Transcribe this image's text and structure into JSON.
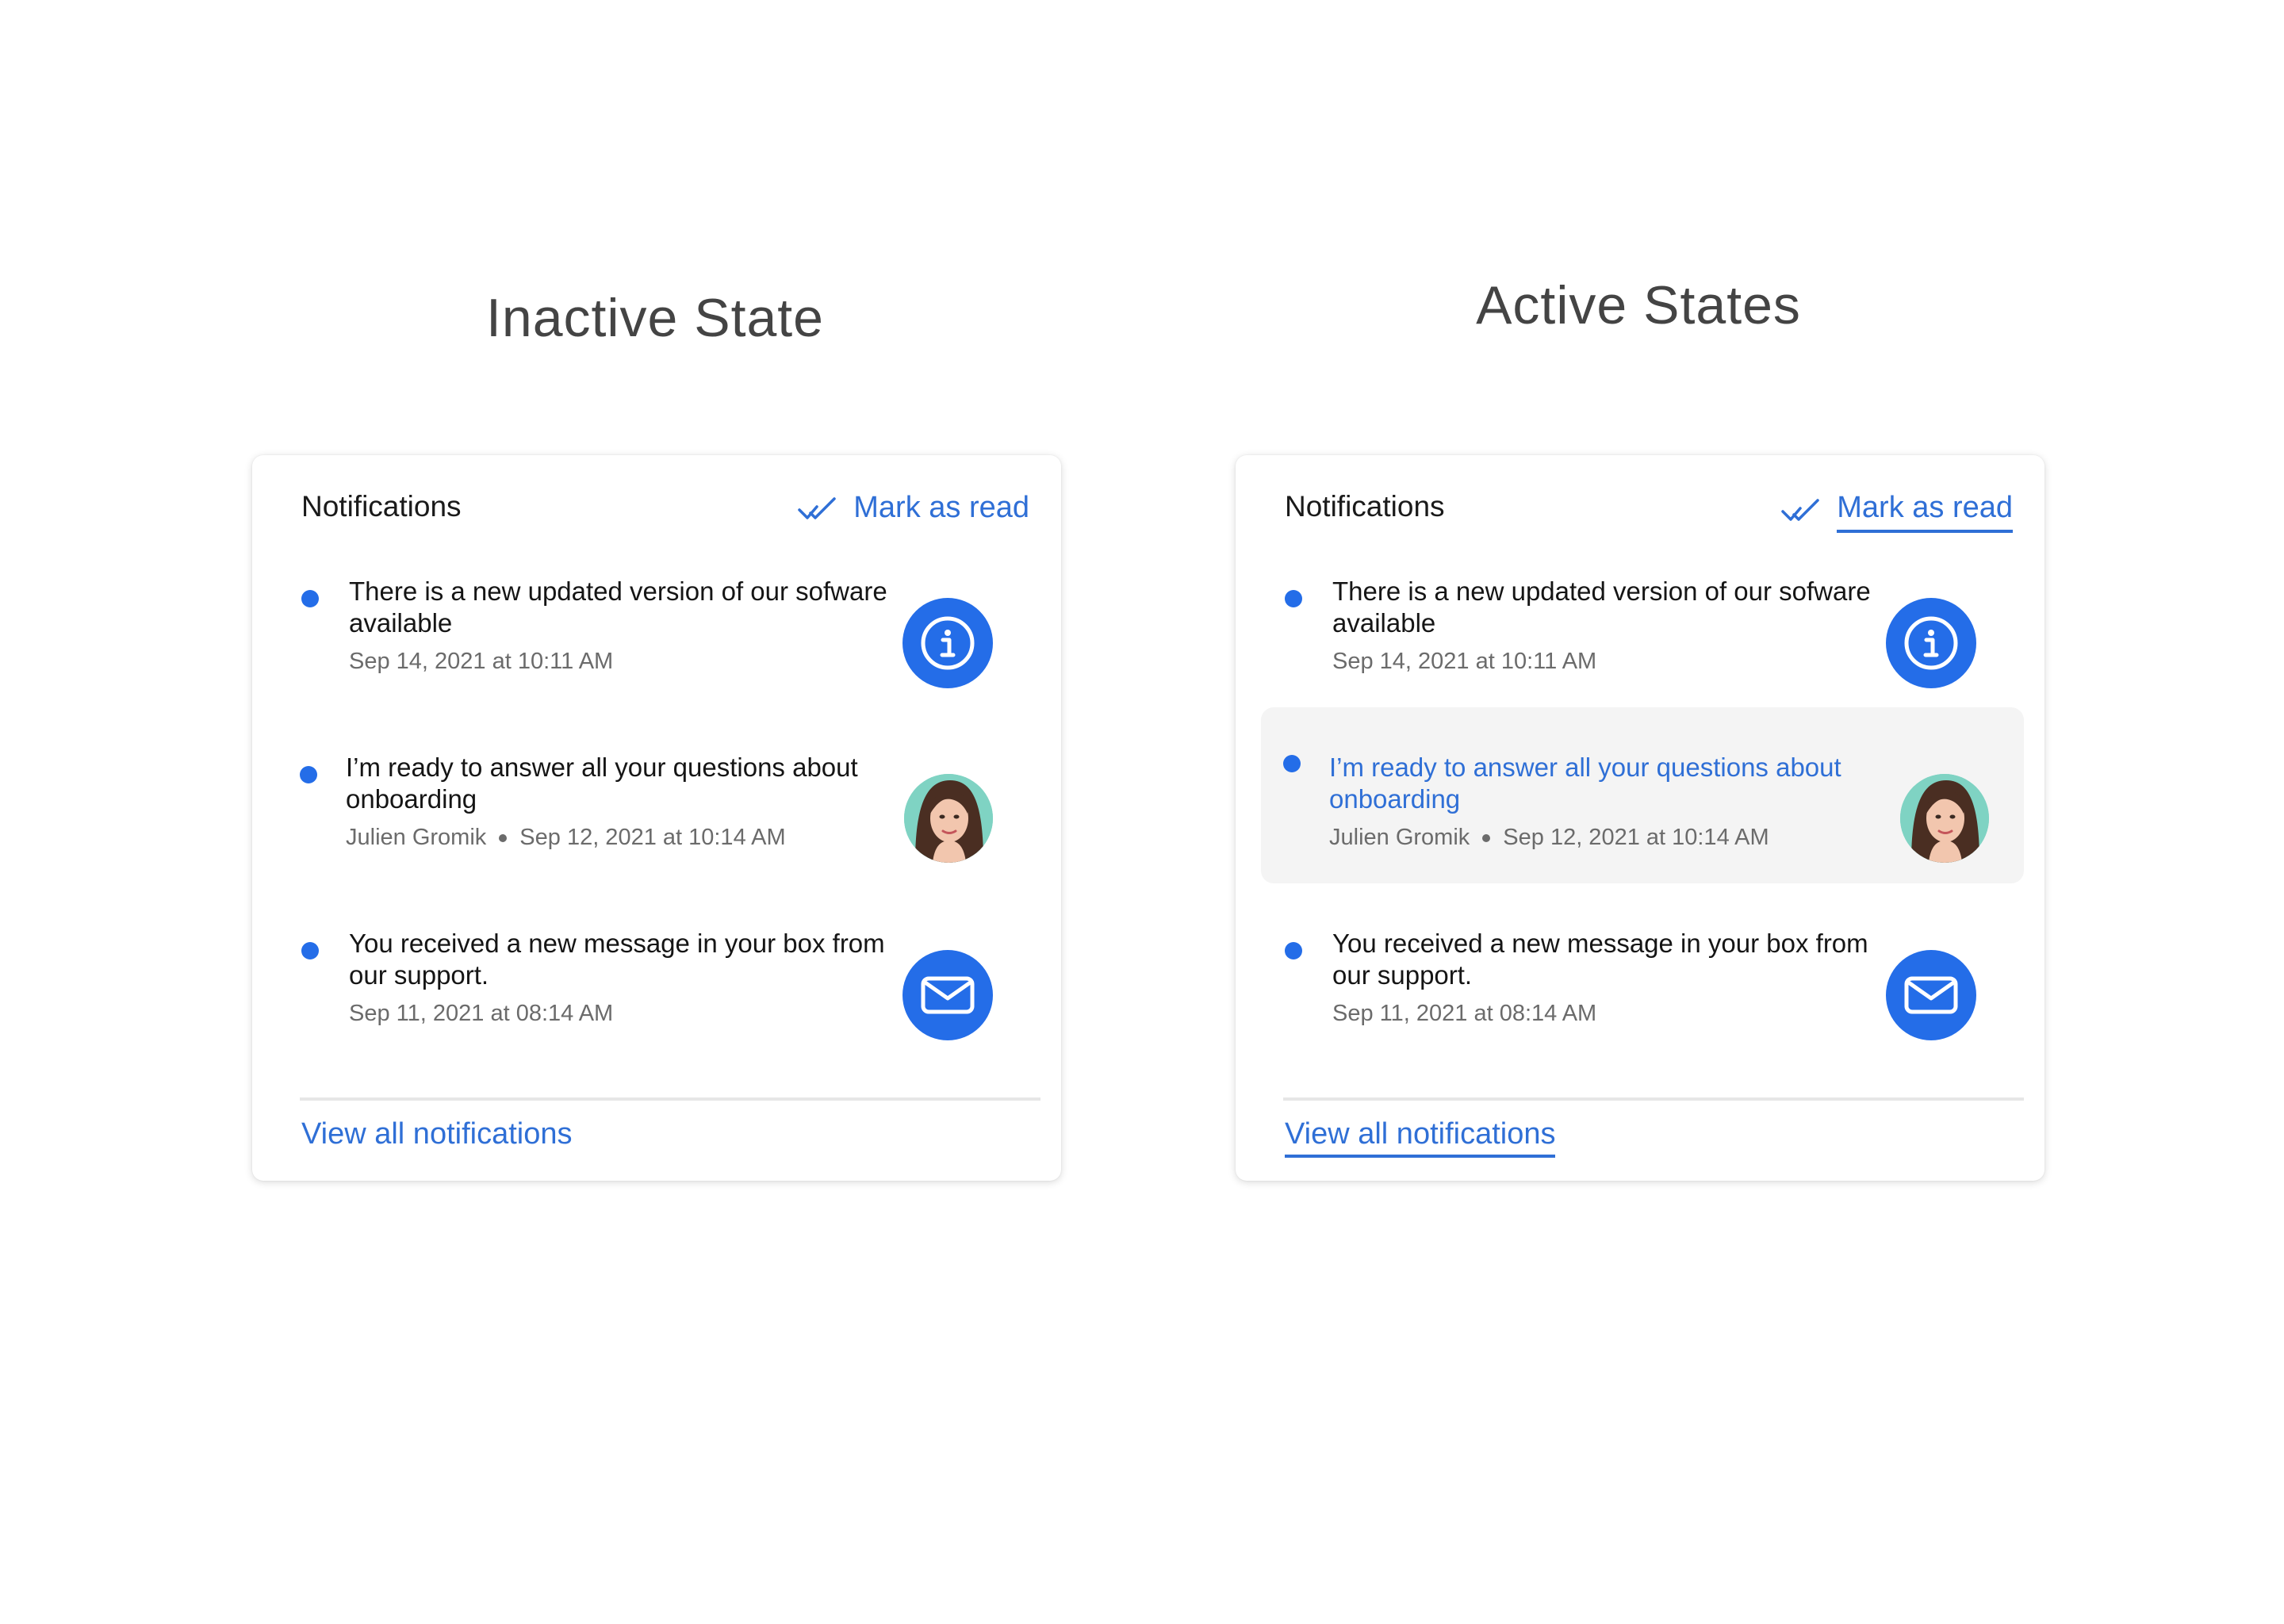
{
  "colors": {
    "accent": "#246de8",
    "link": "#2f6fd6",
    "hover_background": "#f4f4f4",
    "text": "#151515",
    "meta_text": "#6b6b6b"
  },
  "inactive": {
    "section_title": "Inactive State",
    "panel": {
      "title": "Notifications",
      "mark_as_read": "Mark as read",
      "view_all": "View all notifications",
      "items": [
        {
          "message": "There is a new updated version of our sofware available",
          "author": "",
          "date": "Sep 14, 2021 at 10:11 AM",
          "icon": "info-icon"
        },
        {
          "message": "I’m ready to answer all your questions about onboarding",
          "author": "Julien Gromik",
          "date": "Sep 12, 2021 at 10:14 AM",
          "icon": "avatar"
        },
        {
          "message": "You received a new message in your box from our support.",
          "author": "",
          "date": "Sep 11, 2021 at 08:14 AM",
          "icon": "mail-icon"
        }
      ]
    }
  },
  "active": {
    "section_title": "Active States",
    "panel": {
      "title": "Notifications",
      "mark_as_read": "Mark as read",
      "view_all": "View all notifications",
      "items": [
        {
          "message": "There is a new updated version of our sofware available",
          "author": "",
          "date": "Sep 14, 2021 at 10:11 AM",
          "icon": "info-icon"
        },
        {
          "message": "I’m ready to answer all your questions about onboarding",
          "author": "Julien Gromik",
          "date": "Sep 12, 2021 at 10:14 AM",
          "icon": "avatar",
          "state": "hover"
        },
        {
          "message": "You received a new message in your box from our support.",
          "author": "",
          "date": "Sep 11, 2021 at 08:14 AM",
          "icon": "mail-icon"
        }
      ]
    }
  }
}
